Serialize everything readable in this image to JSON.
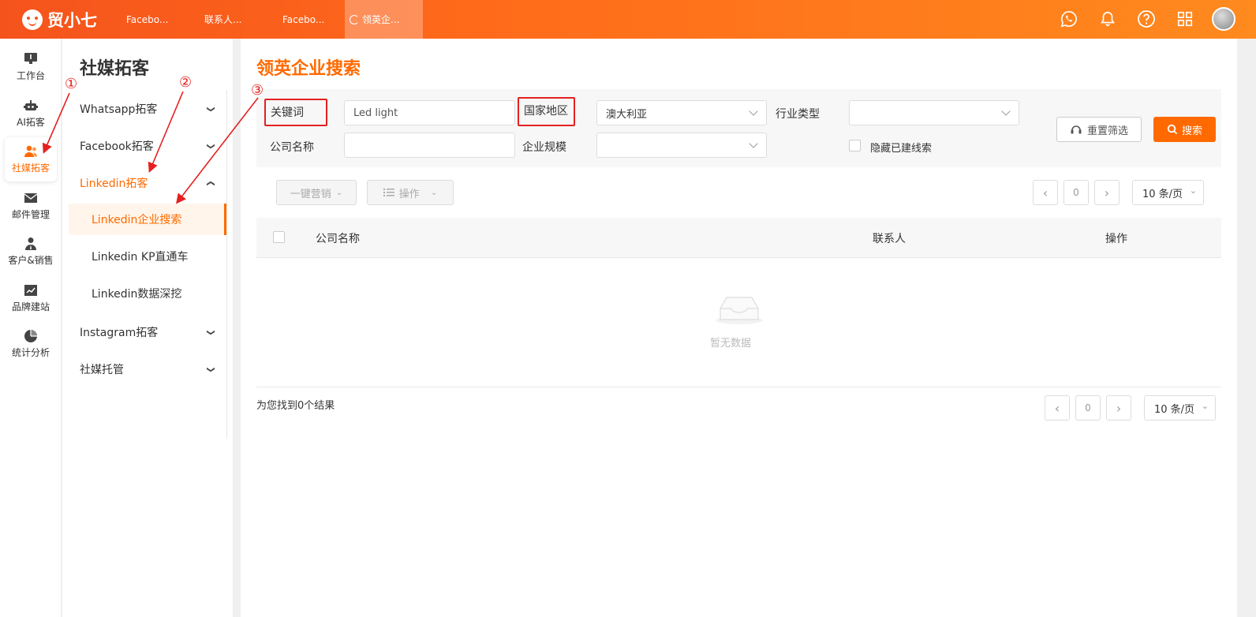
{
  "app": {
    "logo_text": "贸小七"
  },
  "tabs": [
    {
      "label": "Facebo..."
    },
    {
      "label": "联系人..."
    },
    {
      "label": "Facebo..."
    },
    {
      "label": "领英企..."
    }
  ],
  "top_icons": [
    "whatsapp-icon",
    "bell-icon",
    "help-icon",
    "apps-grid-icon",
    "avatar"
  ],
  "rail": [
    {
      "label": "工作台",
      "icon": "desk-icon"
    },
    {
      "label": "AI拓客",
      "icon": "robot-icon"
    },
    {
      "label": "社媒拓客",
      "icon": "people-icon",
      "active": true
    },
    {
      "label": "邮件管理",
      "icon": "mail-icon"
    },
    {
      "label": "客户&销售",
      "icon": "user-tie-icon"
    },
    {
      "label": "品牌建站",
      "icon": "chart-line-icon"
    },
    {
      "label": "统计分析",
      "icon": "pie-chart-icon"
    }
  ],
  "sidebar": {
    "title": "社媒拓客",
    "menus": [
      {
        "label": "Whatsapp拓客"
      },
      {
        "label": "Facebook拓客"
      },
      {
        "label": "Linkedin拓客",
        "open": true
      },
      {
        "label": "Instagram拓客"
      },
      {
        "label": "社媒托管"
      }
    ],
    "submenus": [
      {
        "label": "Linkedin企业搜索",
        "active": true
      },
      {
        "label": "Linkedin KP直通车"
      },
      {
        "label": "Linkedin数据深挖"
      }
    ]
  },
  "main": {
    "title": "领英企业搜索",
    "filters": {
      "keyword_label": "关键词",
      "keyword_value": "Led light",
      "country_label": "国家地区",
      "country_value": "澳大利亚",
      "industry_label": "行业类型",
      "industry_value": "",
      "company_label": "公司名称",
      "company_value": "",
      "scale_label": "企业规模",
      "scale_value": "",
      "hide_label": "隐藏已建线索",
      "reset_label": "重置筛选",
      "search_label": "搜索"
    },
    "toolbar": {
      "marketing_label": "一键营销",
      "ops_label": "操作",
      "page_current": "0",
      "page_size": "10 条/页"
    },
    "table": {
      "headers": [
        "公司名称",
        "联系人",
        "操作"
      ],
      "empty_text": "暂无数据"
    },
    "result_text": "为您找到0个结果",
    "bottom_pager": {
      "page_current": "0",
      "page_size": "10 条/页"
    }
  },
  "annotations": [
    "①",
    "②",
    "③"
  ],
  "colors": {
    "brand": "#ff6a00",
    "annotation": "#e52020"
  }
}
